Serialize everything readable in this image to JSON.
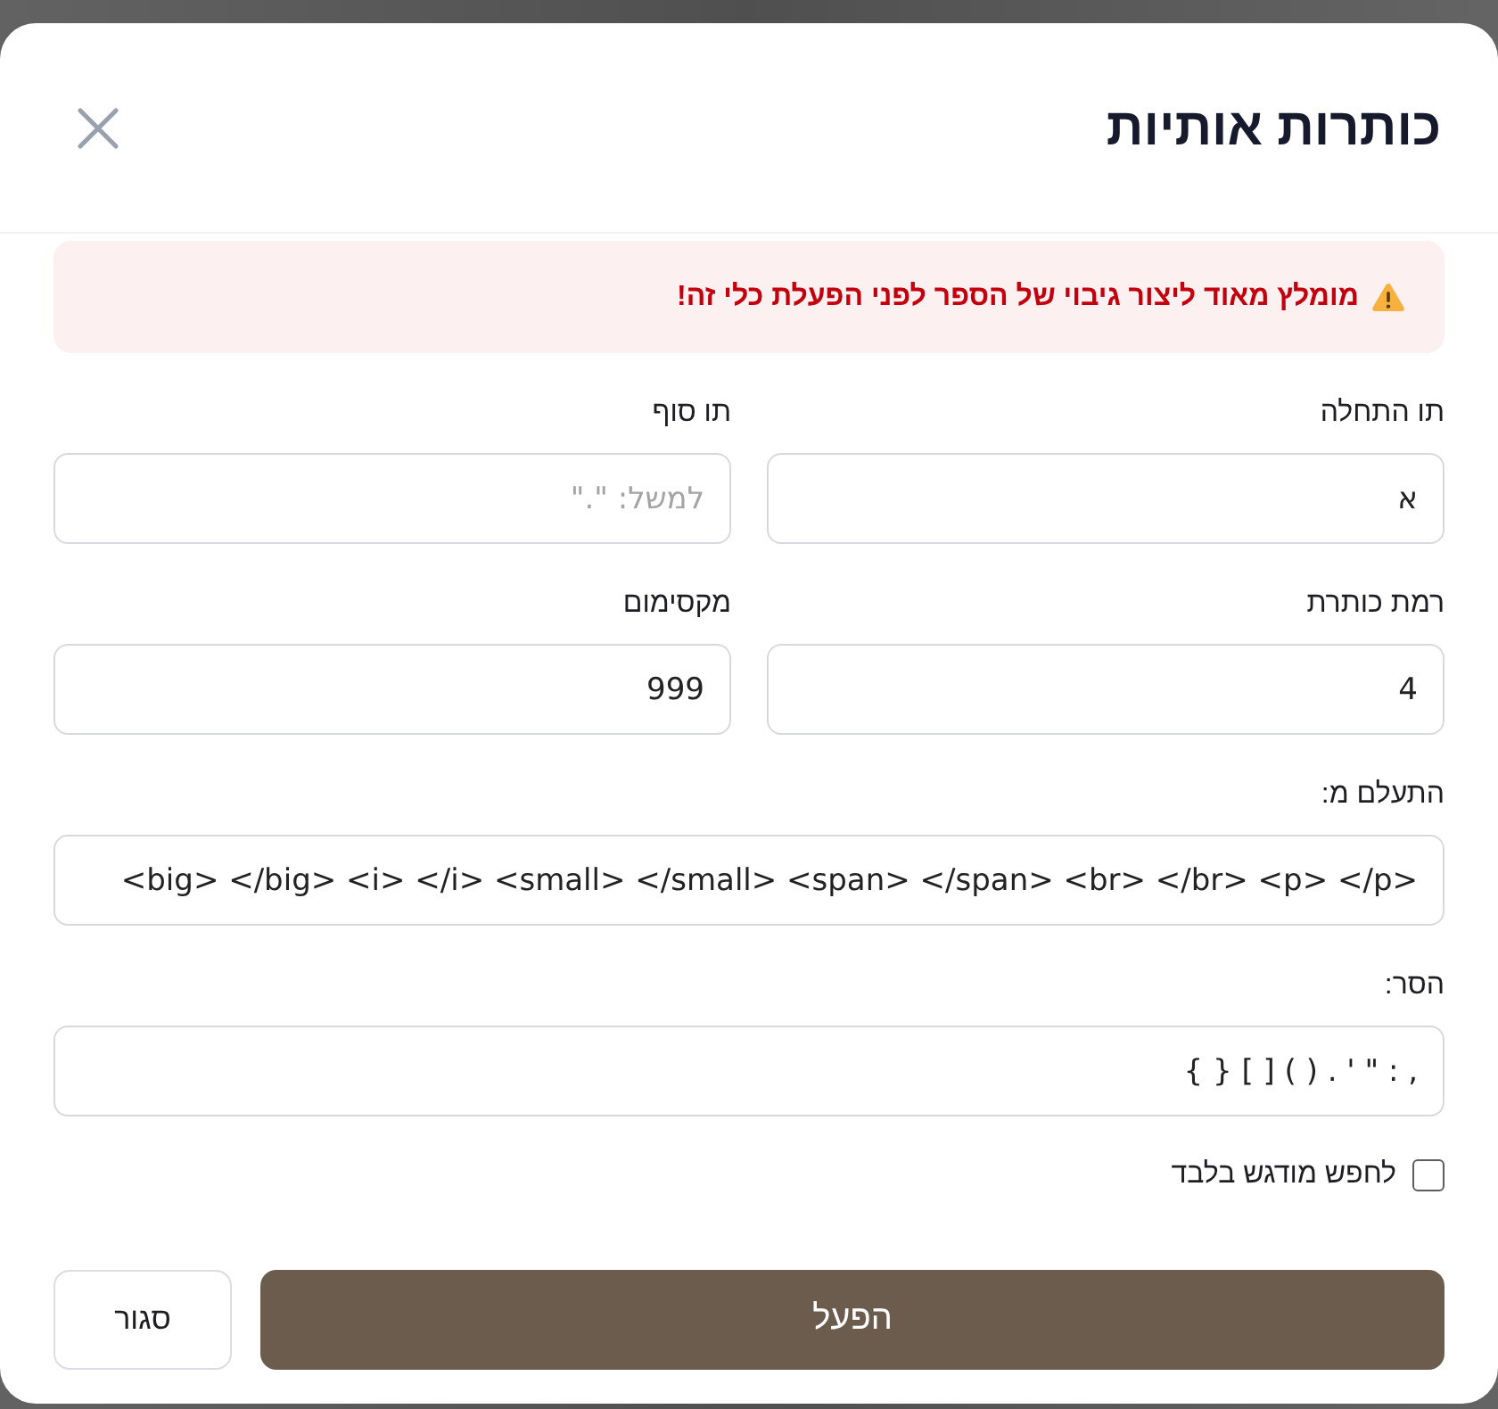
{
  "dialog": {
    "title": "כותרות אותיות"
  },
  "warning": {
    "text": "מומלץ מאוד ליצור גיבוי של הספר לפני הפעלת כלי זה!"
  },
  "form": {
    "rows": [
      {
        "fields": [
          {
            "label": "תו התחלה",
            "value": "א"
          },
          {
            "label": "תו סוף",
            "placeholder": "למשל: \".\""
          }
        ]
      },
      {
        "fields": [
          {
            "label": "רמת כותרת",
            "value": "4"
          },
          {
            "label": "מקסימום",
            "value": "999"
          }
        ]
      },
      {
        "fields": [
          {
            "label": "התעלם מ:",
            "value": "<big> </big> <i> </i> <small> </small> <span> </span> <br> </br> <p> </p>"
          }
        ]
      },
      {
        "fields": [
          {
            "label": "הסר:",
            "value": "{ } [ ] ( ) . ' \" : ,"
          }
        ]
      }
    ]
  },
  "options": [
    {
      "label": "לחפש מודגש בלבד",
      "checked": false
    }
  ],
  "buttons": [
    {
      "label": "הפעל",
      "kind": "primary"
    },
    {
      "label": "סגור",
      "kind": "secondary"
    }
  ]
}
